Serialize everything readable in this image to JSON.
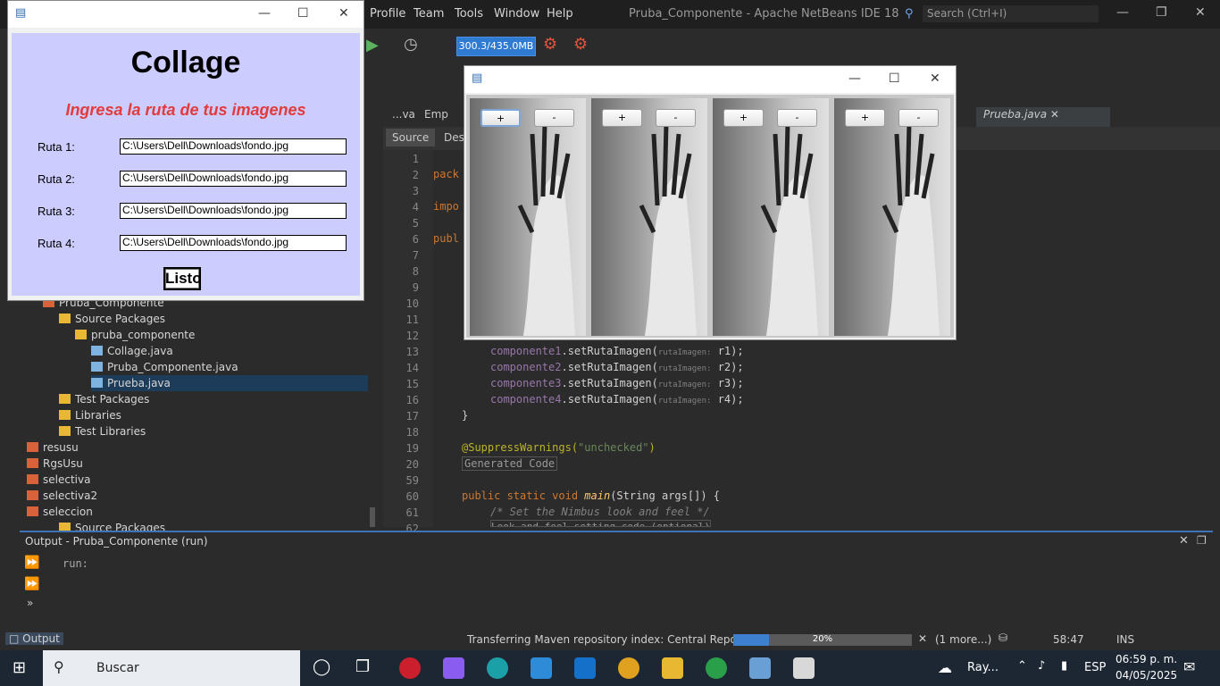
{
  "ide": {
    "title": "Pruba_Componente - Apache NetBeans IDE 18",
    "menu": [
      "Profile",
      "Team",
      "Tools",
      "Window",
      "Help"
    ],
    "search_placeholder": "Search (Ctrl+I)",
    "memory": "300.3/435.0MB",
    "tabs": [
      "...va",
      "Emp",
      "Prueba.java"
    ],
    "source_tabs": [
      "Source",
      "Desi"
    ],
    "line_numbers": [
      "1",
      "2",
      "3",
      "4",
      "5",
      "6",
      "7",
      "8",
      "9",
      "10",
      "11",
      "12",
      "13",
      "14",
      "15",
      "16",
      "17",
      "18",
      "19",
      "20",
      "59",
      "60",
      "61",
      "62"
    ],
    "code": {
      "l2": "pack",
      "l4": "impo",
      "l6": "publ",
      "l13_obj": "componente1",
      "l14_obj": "componente2",
      "l15_obj": "componente3",
      "l16_obj": "componente4",
      "method": ".setRutaImagen(",
      "hint": "rutaImagen:",
      "arg1": " r1);",
      "arg2": " r2);",
      "arg3": " r3);",
      "arg4": " r4);",
      "brace": "}",
      "annotation": "@SuppressWarnings(",
      "annotation_str": "\"unchecked\"",
      "annotation_close": ")",
      "generated": "Generated Code",
      "main_kw": "public static void ",
      "main_fn": "main",
      "main_args": "(String args[]) {",
      "comment": "/* Set the Nimbus look and feel */",
      "fold": "Look and feel setting code (optional)"
    },
    "project_tree": [
      {
        "label": "Pruba_Componente",
        "type": "project"
      },
      {
        "label": "Source Packages",
        "type": "folder"
      },
      {
        "label": "pruba_componente",
        "type": "package"
      },
      {
        "label": "Collage.java",
        "type": "file"
      },
      {
        "label": "Pruba_Componente.java",
        "type": "file"
      },
      {
        "label": "Prueba.java",
        "type": "file"
      },
      {
        "label": "Test Packages",
        "type": "folder"
      },
      {
        "label": "Libraries",
        "type": "folder"
      },
      {
        "label": "Test Libraries",
        "type": "folder"
      },
      {
        "label": "resusu",
        "type": "project"
      },
      {
        "label": "RgsUsu",
        "type": "project"
      },
      {
        "label": "selectiva",
        "type": "project"
      },
      {
        "label": "selectiva2",
        "type": "project"
      },
      {
        "label": "seleccion",
        "type": "project"
      },
      {
        "label": "Source Packages",
        "type": "folder"
      }
    ],
    "output_title": "Output - Pruba_Componente (run)",
    "output_text": "run:",
    "status": {
      "output_tab": "Output",
      "task": "Transferring Maven repository index: Central Repository",
      "progress_label": "20%",
      "progress": 0.2,
      "more": "(1 more...)",
      "position": "58:47",
      "mode": "INS"
    }
  },
  "collage": {
    "title": "Collage",
    "subtitle": "Ingresa la ruta de tus imagenes",
    "rows": [
      {
        "label": "Ruta 1:",
        "value": "C:\\Users\\Dell\\Downloads\\fondo.jpg"
      },
      {
        "label": "Ruta 2:",
        "value": "C:\\Users\\Dell\\Downloads\\fondo.jpg"
      },
      {
        "label": "Ruta 3:",
        "value": "C:\\Users\\Dell\\Downloads\\fondo.jpg"
      },
      {
        "label": "Ruta 4:",
        "value": "C:\\Users\\Dell\\Downloads\\fondo.jpg"
      }
    ],
    "button": "Listo"
  },
  "viewer": {
    "plus": "+",
    "minus": "-"
  },
  "taskbar": {
    "search": "Buscar",
    "weather": "Ray...",
    "lang": "ESP",
    "time": "06:59 p. m.",
    "date": "04/05/2025"
  }
}
